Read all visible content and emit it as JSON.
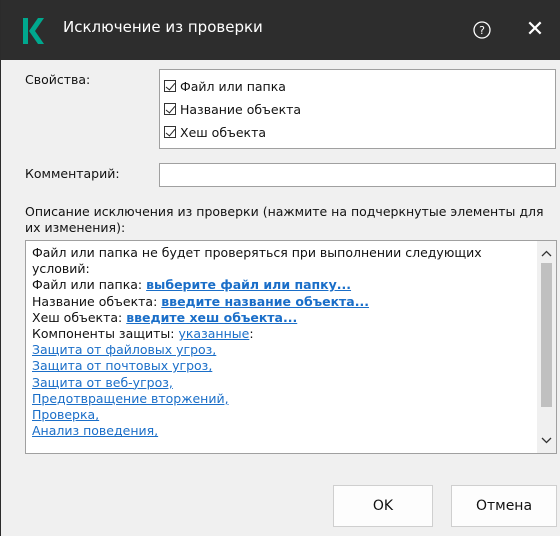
{
  "window": {
    "title": "Исключение из проверки",
    "help_icon": "question-circle-icon",
    "close_icon": "close-icon",
    "close_glyph": "✕",
    "logo_icon": "kaspersky-k-logo",
    "accent_color": "#00a88e"
  },
  "properties": {
    "label": "Свойства:",
    "items": [
      {
        "label": "Файл или папка",
        "checked": true
      },
      {
        "label": "Название объекта",
        "checked": true
      },
      {
        "label": "Хеш объекта",
        "checked": true
      }
    ]
  },
  "comment": {
    "label": "Комментарий:",
    "value": ""
  },
  "description": {
    "label": "Описание исключения из проверки (нажмите на подчеркнутые элементы для их изменения):",
    "intro_line1": "Файл или папка не будет проверяться при выполнении следующих",
    "intro_line2": "условий:",
    "file_label": "Файл или папка: ",
    "file_link": "выберите файл или папку...",
    "name_label": "Название объекта: ",
    "name_link": "введите название объекта...",
    "hash_label": "Хеш объекта: ",
    "hash_link": "введите хеш объекта...",
    "components_label": "Компоненты защиты: ",
    "components_link": "указанные",
    "components_suffix": ":",
    "components": [
      "Защита от файловых угроз,",
      "Защита от почтовых угроз,",
      "Защита от веб-угроз,",
      "Предотвращение вторжений,",
      "Проверка,",
      "Анализ поведения,"
    ]
  },
  "buttons": {
    "ok": "OK",
    "cancel": "Отмена"
  }
}
